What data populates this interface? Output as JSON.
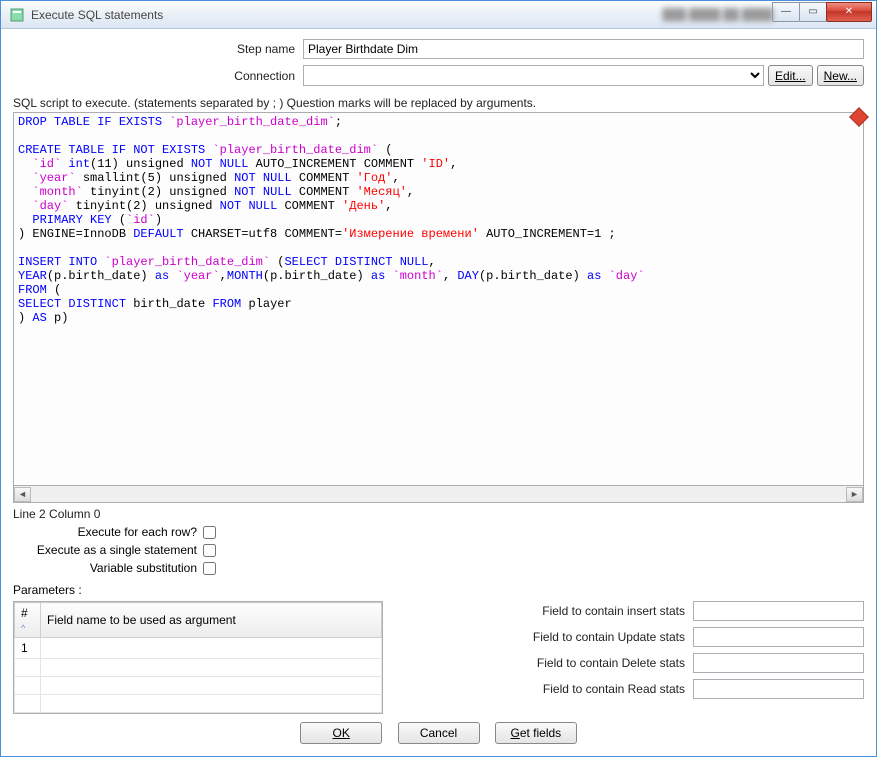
{
  "window": {
    "title": "Execute SQL statements"
  },
  "form": {
    "step_name_label": "Step name",
    "step_name_value": "Player Birthdate Dim",
    "connection_label": "Connection",
    "connection_value": "",
    "edit_label": "Edit...",
    "new_label": "New..."
  },
  "script_label": "SQL script to execute. (statements separated by ; ) Question marks will be replaced by arguments.",
  "status": "Line 2 Column 0",
  "checks": {
    "each_row_label": "Execute for each row?",
    "single_stmt_label": "Execute as a single statement",
    "var_sub_label": "Variable substitution"
  },
  "params_label": "Parameters :",
  "grid": {
    "col_num": "#",
    "col_field": "Field name to be used as argument",
    "row1_num": "1"
  },
  "stats": {
    "insert_label": "Field to contain insert stats",
    "update_label": "Field to contain Update stats",
    "delete_label": "Field to contain Delete stats",
    "read_label": "Field to contain Read stats"
  },
  "buttons": {
    "ok": "OK",
    "cancel": "Cancel",
    "getfields": "Get fields"
  },
  "sql": {
    "tokens": [
      {
        "t": "kw",
        "v": "DROP TABLE IF EXISTS"
      },
      {
        "t": "p",
        "v": " "
      },
      {
        "t": "bt",
        "v": "`player_birth_date_dim`"
      },
      {
        "t": "p",
        "v": ";\n\n"
      },
      {
        "t": "kw",
        "v": "CREATE TABLE IF NOT EXISTS"
      },
      {
        "t": "p",
        "v": " "
      },
      {
        "t": "bt",
        "v": "`player_birth_date_dim`"
      },
      {
        "t": "p",
        "v": " (\n  "
      },
      {
        "t": "bt",
        "v": "`id`"
      },
      {
        "t": "p",
        "v": " "
      },
      {
        "t": "kw",
        "v": "int"
      },
      {
        "t": "p",
        "v": "(11) unsigned "
      },
      {
        "t": "kw",
        "v": "NOT NULL"
      },
      {
        "t": "p",
        "v": " AUTO_INCREMENT COMMENT "
      },
      {
        "t": "str",
        "v": "'ID'"
      },
      {
        "t": "p",
        "v": ",\n  "
      },
      {
        "t": "bt",
        "v": "`year`"
      },
      {
        "t": "p",
        "v": " smallint(5) unsigned "
      },
      {
        "t": "kw",
        "v": "NOT NULL"
      },
      {
        "t": "p",
        "v": " COMMENT "
      },
      {
        "t": "str",
        "v": "'Год'"
      },
      {
        "t": "p",
        "v": ",\n  "
      },
      {
        "t": "bt",
        "v": "`month`"
      },
      {
        "t": "p",
        "v": " tinyint(2) unsigned "
      },
      {
        "t": "kw",
        "v": "NOT NULL"
      },
      {
        "t": "p",
        "v": " COMMENT "
      },
      {
        "t": "str",
        "v": "'Месяц'"
      },
      {
        "t": "p",
        "v": ",\n  "
      },
      {
        "t": "bt",
        "v": "`day`"
      },
      {
        "t": "p",
        "v": " tinyint(2) unsigned "
      },
      {
        "t": "kw",
        "v": "NOT NULL"
      },
      {
        "t": "p",
        "v": " COMMENT "
      },
      {
        "t": "str",
        "v": "'День'"
      },
      {
        "t": "p",
        "v": ",\n  "
      },
      {
        "t": "kw",
        "v": "PRIMARY KEY"
      },
      {
        "t": "p",
        "v": " ("
      },
      {
        "t": "bt",
        "v": "`id`"
      },
      {
        "t": "p",
        "v": ")\n) ENGINE=InnoDB "
      },
      {
        "t": "kw",
        "v": "DEFAULT"
      },
      {
        "t": "p",
        "v": " CHARSET=utf8 COMMENT="
      },
      {
        "t": "str",
        "v": "'Измерение времени'"
      },
      {
        "t": "p",
        "v": " AUTO_INCREMENT=1 ;\n\n"
      },
      {
        "t": "kw",
        "v": "INSERT INTO"
      },
      {
        "t": "p",
        "v": " "
      },
      {
        "t": "bt",
        "v": "`player_birth_date_dim`"
      },
      {
        "t": "p",
        "v": " ("
      },
      {
        "t": "kw",
        "v": "SELECT DISTINCT NULL"
      },
      {
        "t": "p",
        "v": ",\n"
      },
      {
        "t": "kw",
        "v": "YEAR"
      },
      {
        "t": "p",
        "v": "(p.birth_date) "
      },
      {
        "t": "kw",
        "v": "as"
      },
      {
        "t": "p",
        "v": " "
      },
      {
        "t": "bt",
        "v": "`year`"
      },
      {
        "t": "p",
        "v": ","
      },
      {
        "t": "kw",
        "v": "MONTH"
      },
      {
        "t": "p",
        "v": "(p.birth_date) "
      },
      {
        "t": "kw",
        "v": "as"
      },
      {
        "t": "p",
        "v": " "
      },
      {
        "t": "bt",
        "v": "`month`"
      },
      {
        "t": "p",
        "v": ", "
      },
      {
        "t": "kw",
        "v": "DAY"
      },
      {
        "t": "p",
        "v": "(p.birth_date) "
      },
      {
        "t": "kw",
        "v": "as"
      },
      {
        "t": "p",
        "v": " "
      },
      {
        "t": "bt",
        "v": "`day`"
      },
      {
        "t": "p",
        "v": "\n"
      },
      {
        "t": "kw",
        "v": "FROM"
      },
      {
        "t": "p",
        "v": " (\n"
      },
      {
        "t": "kw",
        "v": "SELECT DISTINCT"
      },
      {
        "t": "p",
        "v": " birth_date "
      },
      {
        "t": "kw",
        "v": "FROM"
      },
      {
        "t": "p",
        "v": " player\n) "
      },
      {
        "t": "kw",
        "v": "AS"
      },
      {
        "t": "p",
        "v": " p)"
      }
    ]
  }
}
